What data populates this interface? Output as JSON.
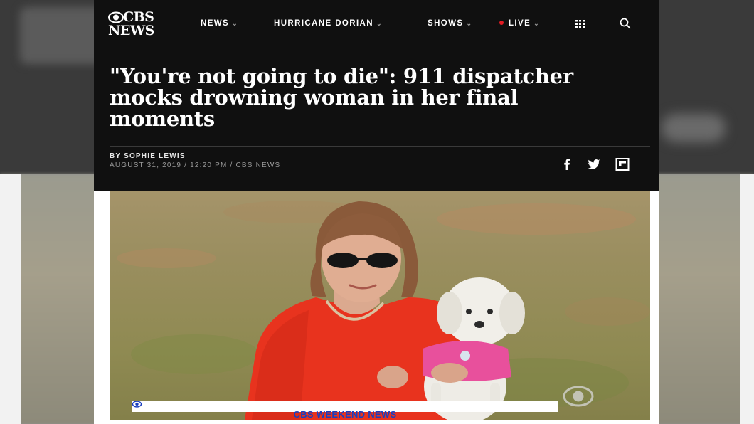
{
  "nav": {
    "logo_line1": "CBS",
    "logo_line2": "NEWS",
    "items": [
      {
        "label": "NEWS",
        "icon": "chevron-down-icon"
      },
      {
        "label": "HURRICANE DORIAN",
        "icon": "chevron-down-icon"
      },
      {
        "label": "SHOWS",
        "icon": "chevron-down-icon"
      },
      {
        "label": "LIVE",
        "icon": "chevron-down-icon",
        "dot_color": "#e31b23"
      }
    ],
    "chevron_glyph": "⌄",
    "grid_icon": "grid-icon",
    "search_icon": "search-icon"
  },
  "article": {
    "headline": "\"You're not going to die\": 911 dispatcher mocks drowning woman in her final moments",
    "byline": "BY SOPHIE LEWIS",
    "meta": "AUGUST 31, 2019 / 12:20 PM / CBS NEWS"
  },
  "share": [
    "facebook-icon",
    "twitter-icon",
    "flipboard-icon"
  ],
  "photo": {
    "lower_third": "CBS WEEKEND NEWS",
    "bug_icon": "cbs-eye-icon"
  },
  "colors": {
    "header_bg": "#101010",
    "text": "#ffffff",
    "meta": "#9a9a9a",
    "live": "#e31b23",
    "lower_third_text": "#1a3fc0"
  }
}
